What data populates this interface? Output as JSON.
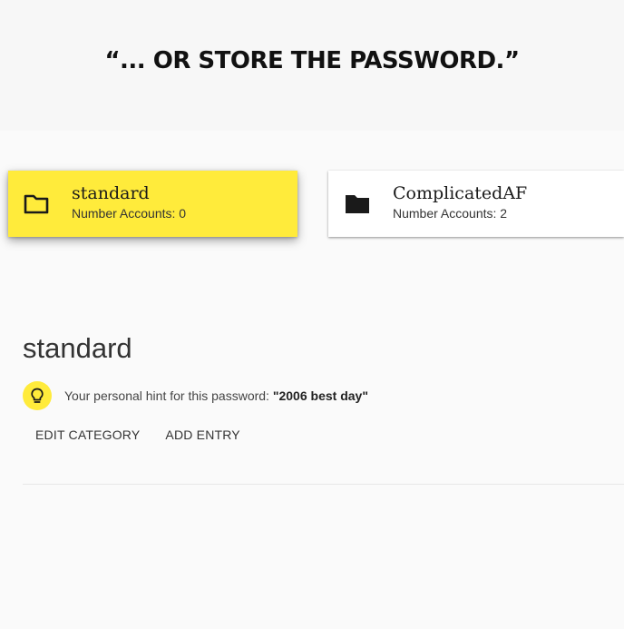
{
  "caption": "“... OR STORE THE PASSWORD.”",
  "categories": [
    {
      "name": "standard",
      "count_text": "Number Accounts: 0",
      "icon": "folder-outline-icon",
      "selected": true
    },
    {
      "name": "ComplicatedAF",
      "count_text": "Number Accounts: 2",
      "icon": "folder-filled-icon",
      "selected": false
    }
  ],
  "detail": {
    "title": "standard",
    "hint_icon": "lightbulb-icon",
    "hint_prefix": "Your personal hint for this password: ",
    "hint_value": "\"2006 best day\"",
    "actions": [
      "EDIT CATEGORY",
      "ADD ENTRY"
    ]
  },
  "colors": {
    "accent": "#ffeb3b",
    "card_bg": "#ffffff",
    "page_bg": "#fafafa"
  }
}
